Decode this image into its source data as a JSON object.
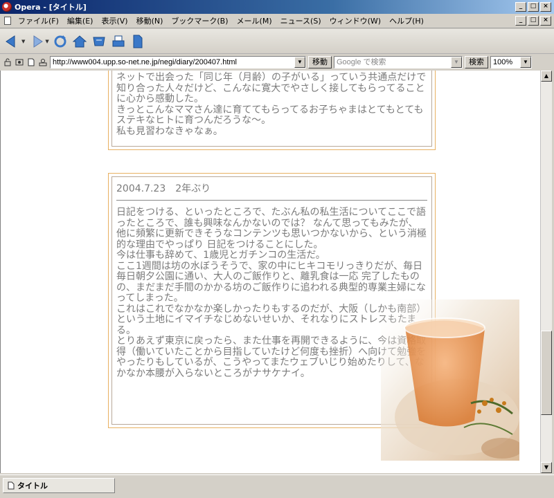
{
  "window": {
    "title": "Opera - [タイトル]",
    "buttons": {
      "minimize": "_",
      "maximize": "□",
      "close": "×"
    }
  },
  "menu": {
    "items": [
      "ファイル(F)",
      "編集(E)",
      "表示(V)",
      "移動(N)",
      "ブックマーク(B)",
      "メール(M)",
      "ニュース(S)",
      "ウィンドウ(W)",
      "ヘルプ(H)"
    ]
  },
  "toolbar": {
    "icons": [
      "back-icon",
      "forward-icon",
      "reload-icon",
      "home-icon",
      "hotlist-icon",
      "print-icon",
      "document-icon"
    ]
  },
  "address": {
    "url": "http://www004.upp.so-net.ne.jp/negi/diary/200407.html",
    "go_label": "移動",
    "search_placeholder": "Google で検索",
    "search_label": "検索",
    "zoom": "100%"
  },
  "entries": [
    {
      "text": "ネットで出会った「同じ年（月齢）の子がいる」っていう共通点だけで知り合った人々だけど、こんなに寛大でやさしく接してもらってることに心から感動した。\nきっとこんなママさん達に育ててもらってるお子ちゃまはとてもとてもステキなヒトに育つんだろうな〜。\n私も見習わなきゃなぁ。"
    },
    {
      "heading": "2004.7.23　2年ぶり",
      "text": "日記をつける、といったところで、たぶん私の私生活についてここで語ったところで、誰も興味なんかないのでは？ なんて思ってもみたが、他に頻繁に更新できそうなコンテンツも思いつかないから、という消極的な理由でやっぱり 日記をつけることにした。\n今は仕事も辞めて、1歳児とガチンコの生活だ。\nここ1週間は坊の水ぼうそうで、家の中にヒキコモリっきりだが、毎日毎日朝夕公園に通い、大人のご飯作りと、離乳食は一応 完了したものの、まだまだ手間のかかる坊のご飯作りに追われる典型的専業主婦になってしまった。\nこれはこれでなかなか楽しかったりもするのだが、大阪（しかも南部）という土地にイマイチなじめないせいか、それなりにストレスもたまる。\nとりあえず東京に戻ったら、また仕事を再開できるように、今は資格取得（働いていたことから目指していたけど何度も挫折）へ向けて勉強をやったりもしているが、こうやってまたウェブいじり始めたりして、なかなか本腰が入らないところがナサケナイ。"
    }
  ],
  "scroll": {
    "position_fraction": 0.84
  },
  "statusbar": {
    "tab_label": "タイトル"
  },
  "colors": {
    "titlebar": "#0a246a",
    "entry_border": "#e8b060",
    "body_text": "#7a7a7a"
  }
}
